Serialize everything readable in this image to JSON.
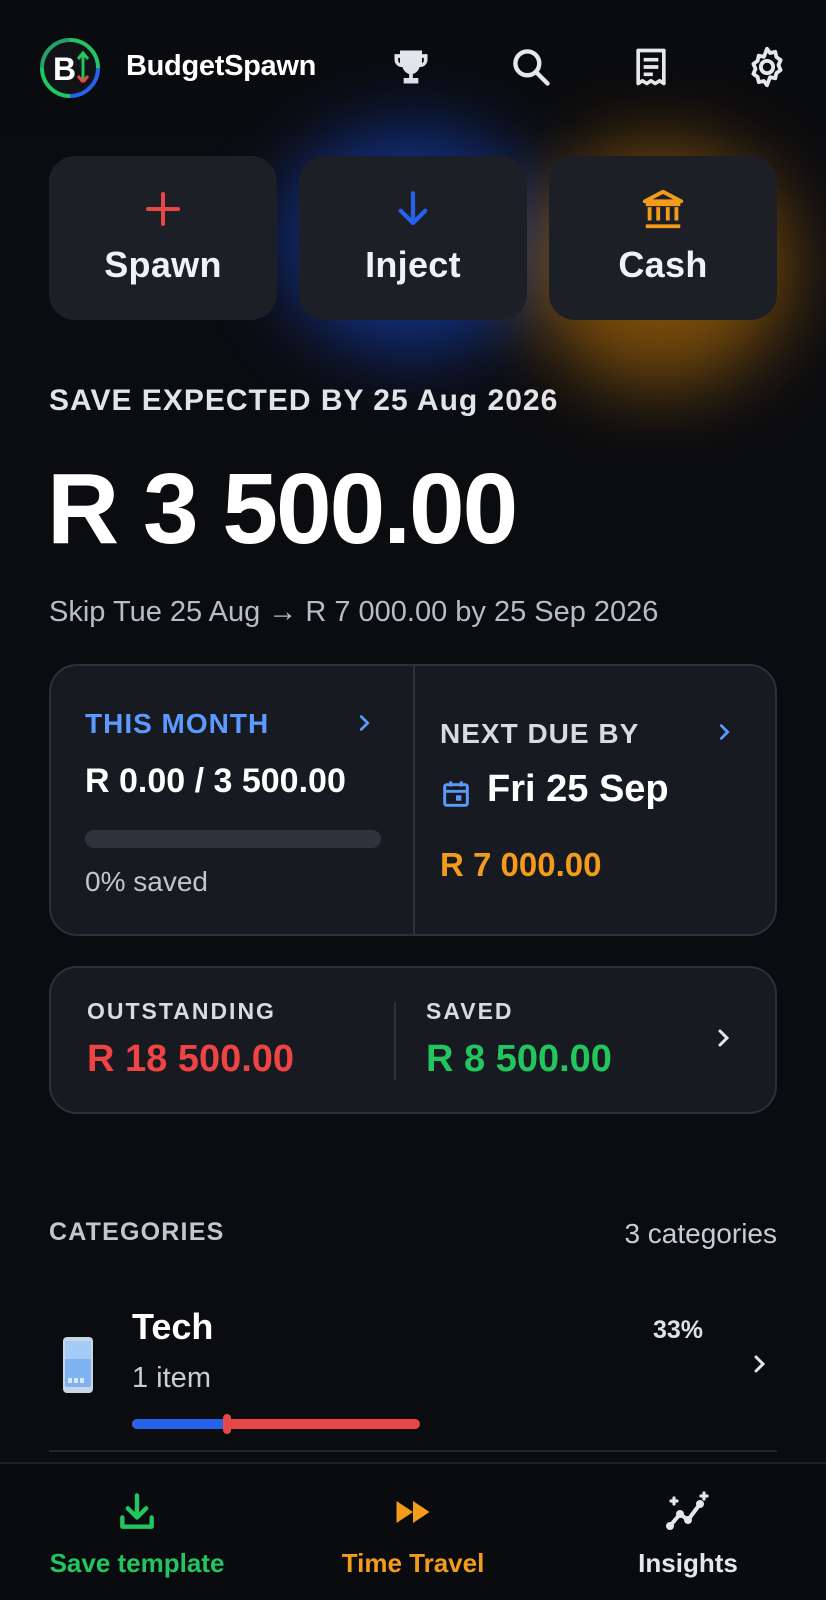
{
  "header": {
    "app_name": "BudgetSpawn",
    "logo_letter": "B",
    "icons": [
      "trophy-icon",
      "search-icon",
      "receipt-icon",
      "gear-icon"
    ]
  },
  "actions": [
    {
      "label": "Spawn",
      "icon": "plus-icon",
      "color": "#e84747"
    },
    {
      "label": "Inject",
      "icon": "arrow-down-icon",
      "color": "#2563eb"
    },
    {
      "label": "Cash",
      "icon": "bank-icon",
      "color": "#f39c1b"
    }
  ],
  "summary": {
    "save_expected": "SAVE EXPECTED BY 25 Aug 2026",
    "amount": "R 3 500.00",
    "skip_line": "Skip Tue 25 Aug → R 7 000.00 by 25 Sep 2026"
  },
  "month_card": {
    "this_month_label": "THIS MONTH",
    "this_month_amount": "R 0.00 / 3 500.00",
    "progress": 0,
    "saved_text": "0% saved",
    "next_due_label": "NEXT DUE BY",
    "next_due_date": "Fri 25 Sep",
    "next_due_amount": "R 7 000.00"
  },
  "totals": {
    "outstanding_label": "OUTSTANDING",
    "outstanding_value": "R 18 500.00",
    "saved_label": "SAVED",
    "saved_value": "R 8 500.00"
  },
  "categories": {
    "heading": "CATEGORIES",
    "count": "3 categories",
    "items": [
      {
        "name": "Tech",
        "items": "1 item",
        "percent": "33%",
        "progress": 0.33,
        "icon": "phone-icon"
      }
    ]
  },
  "bottom_nav": [
    {
      "label": "Save template",
      "icon": "download-icon",
      "color": "#22c55e"
    },
    {
      "label": "Time Travel",
      "icon": "fast-forward-icon",
      "color": "#f39c1b"
    },
    {
      "label": "Insights",
      "icon": "sparkle-chart-icon",
      "color": "#e5e7eb"
    }
  ],
  "colors": {
    "accent_blue": "#5b9bff",
    "outstanding": "#ef4444",
    "saved": "#22c55e",
    "due": "#f39c1b"
  }
}
